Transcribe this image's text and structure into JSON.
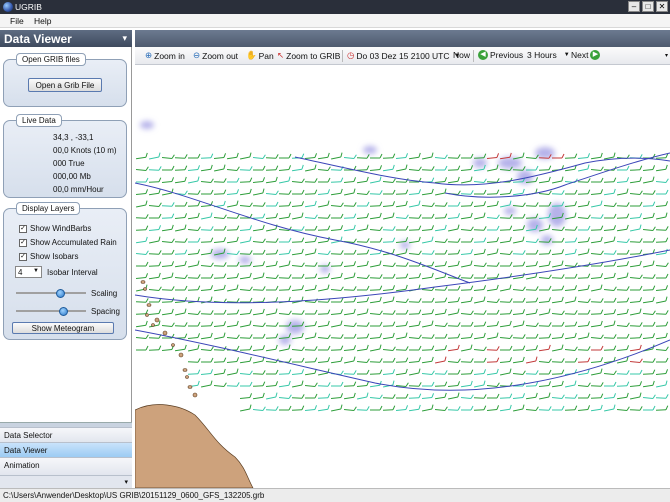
{
  "window": {
    "title": "UGRIB"
  },
  "menu": {
    "file": "File",
    "help": "Help"
  },
  "data_viewer": {
    "title": "Data Viewer"
  },
  "grib_files": {
    "group_title": "Open GRIB files",
    "open_button": "Open a Grib File"
  },
  "live_data": {
    "group_title": "Live Data",
    "position": "34,3 , -33,1",
    "wind": "00,0 Knots (10 m)",
    "direction": "000 True",
    "pressure": "000,00 Mb",
    "rain": "00,0 mm/Hour"
  },
  "layers": {
    "group_title": "Display Layers",
    "windbarbs": {
      "label": "Show WindBarbs",
      "checked": true
    },
    "rain": {
      "label": "Show Accumulated Rain",
      "checked": true
    },
    "isobars": {
      "label": "Show Isobars",
      "checked": true
    },
    "isobar_interval_value": "4",
    "isobar_interval_label": "Isobar Interval",
    "scaling_label": "Scaling",
    "scaling_level": 0.65,
    "spacing_label": "Spacing",
    "spacing_level": 0.7,
    "meteogram_button": "Show Meteogram"
  },
  "nav": {
    "items": [
      "Data Selector",
      "Data Viewer",
      "Animation"
    ],
    "selected": "Data Viewer"
  },
  "toolbar": {
    "zoom_in": "Zoom in",
    "zoom_out": "Zoom out",
    "pan": "Pan",
    "zoom_to_grib": "Zoom to GRIB",
    "datetime": "Do 03 Dez 15 2100 UTC",
    "now": "Now",
    "previous": "Previous",
    "step": "3 Hours",
    "next": "Next"
  },
  "colors": {
    "land": "#cda27c",
    "isobar": "#3b45b8",
    "rain": "#a8a4e6",
    "barb_green": "#2e9e3a",
    "barb_cyan": "#37c8a8",
    "barb_red": "#c23a3a",
    "nav_selected": "#9ccbf3"
  },
  "status": {
    "path": "C:\\Users\\Anwender\\Desktop\\US GRIB\\20151129_0600_GFS_132205.grb"
  }
}
